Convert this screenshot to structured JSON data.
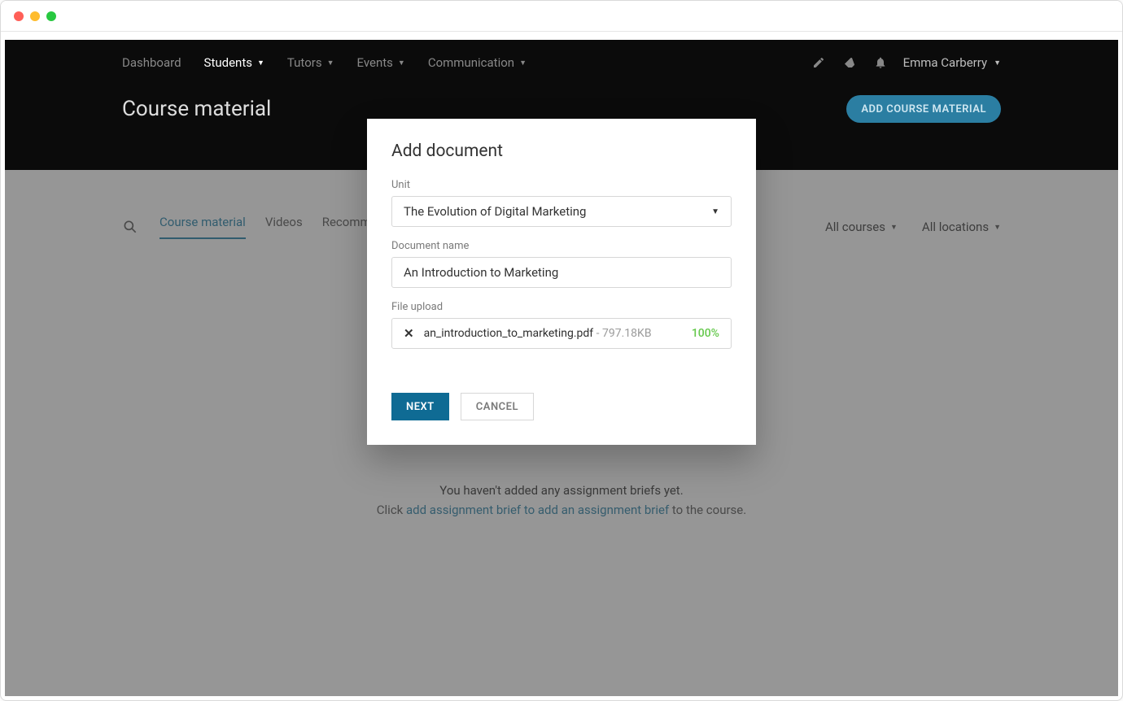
{
  "nav": {
    "dashboard": "Dashboard",
    "students": "Students",
    "tutors": "Tutors",
    "events": "Events",
    "communication": "Communication",
    "user_name": "Emma Carberry"
  },
  "header": {
    "title": "Course material",
    "add_button": "ADD COURSE MATERIAL"
  },
  "tabs": {
    "t1": "Course material",
    "t2": "Videos",
    "t3": "Recommended reading"
  },
  "filters": {
    "courses": "All courses",
    "locations": "All locations"
  },
  "empty": {
    "line1": "You haven't added any assignment briefs  yet.",
    "click": "Click ",
    "link": "add assignment brief to add an assignment brief",
    "tail": " to the course."
  },
  "modal": {
    "title": "Add document",
    "unit_label": "Unit",
    "unit_value": "The Evolution of Digital Marketing",
    "name_label": "Document name",
    "name_value": "An Introduction to Marketing",
    "upload_label": "File upload",
    "file_x": "✕",
    "file_name": "an_introduction_to_marketing.pdf",
    "file_size_prefix": " - ",
    "file_size": "797.18KB",
    "percent": "100%",
    "next": "NEXT",
    "cancel": "CANCEL"
  }
}
